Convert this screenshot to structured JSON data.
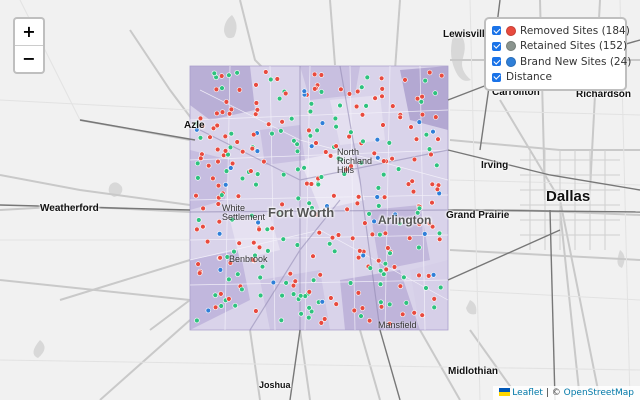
{
  "zoom": {
    "in_label": "+",
    "out_label": "−"
  },
  "layers": [
    {
      "label": "Removed Sites (184)",
      "color": "#e84a3e",
      "checked": true
    },
    {
      "label": "Retained Sites (152)",
      "color": "#8a948e",
      "checked": true
    },
    {
      "label": "Brand New Sites (24)",
      "color": "#2f7fd8",
      "checked": true
    },
    {
      "label": "Distance",
      "checked": true
    }
  ],
  "cities": {
    "lewisville": "Lewisville",
    "carrollton": "Carrollton",
    "richardson": "Richardson",
    "irving": "Irving",
    "dallas": "Dallas",
    "grand_prairie": "Grand Prairie",
    "weatherford": "Weatherford",
    "azle": "Azle",
    "joshua": "Joshua",
    "midlothian": "Midlothian",
    "north_richland_hills": "North Richland Hills",
    "fort_worth": "Fort Worth",
    "arlington": "Arlington",
    "white_settlement": "White Settlement",
    "benbrook": "Benbrook",
    "mansfield": "Mansfield"
  },
  "attribution": {
    "leaflet": "Leaflet",
    "separator": "| ©",
    "osm": "OpenStreetMap"
  },
  "marker_colors": {
    "removed": "#e84a3e",
    "retained": "#2ec27e",
    "brand_new": "#2f7fd8"
  }
}
